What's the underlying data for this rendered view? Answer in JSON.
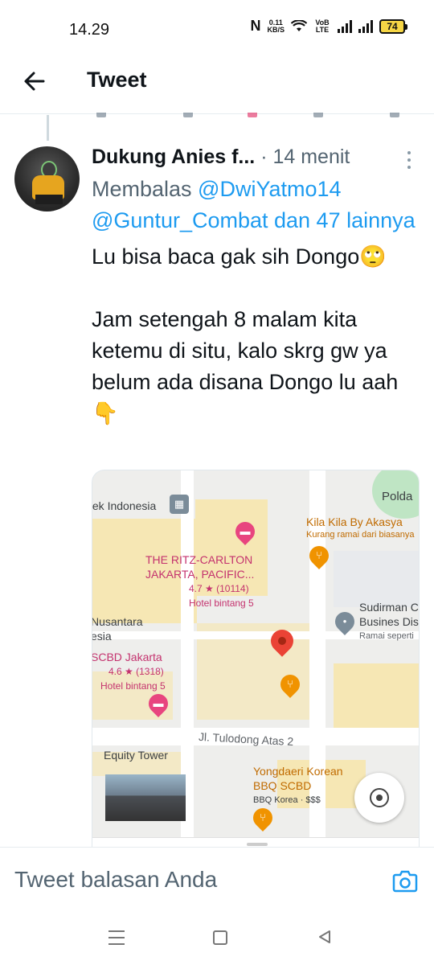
{
  "status_bar": {
    "time": "14.29",
    "net_speed_value": "0.11",
    "net_speed_unit": "KB/S",
    "volte": "VoB LTE",
    "battery": "74"
  },
  "header": {
    "title": "Tweet",
    "back_icon": "arrow-left-icon"
  },
  "tweet": {
    "author_name": "Dukung Anies f...",
    "separator": " · ",
    "timestamp": "14 menit",
    "reply_prefix": "Membalas ",
    "reply_mentions": "@DwiYatmo14 @Guntur_Combat dan 47 lainnya",
    "text": "Lu bisa baca gak sih Dongo🙄\n\nJam setengah 8 malam kita ketemu di situ, kalo skrg gw ya belum ada disana Dongo lu aah 👇"
  },
  "map": {
    "labels": {
      "fek_indonesia": "fek Indonesia",
      "polda": "Polda",
      "kila_kila": "Kila Kila By Akasya",
      "kila_kila_sub": "Kurang ramai dari biasanya",
      "ritz_1": "THE RITZ-CARLTON",
      "ritz_2": "JAKARTA, PACIFIC...",
      "ritz_rating": "4.7 ★ (10114)",
      "ritz_type": "Hotel bintang 5",
      "sudirman_1": "Sudirman C",
      "sudirman_2": "Busines Dis",
      "sudirman_3": "Ramai seperti",
      "nusantara_1": "Nusantara",
      "nusantara_2": "esia",
      "scbd": "SCBD Jakarta",
      "scbd_rating": "4.6 ★ (1318)",
      "scbd_type": "Hotel bintang 5",
      "street": "Jl. Tulodong Atas 2",
      "equity": "Equity Tower",
      "yongdaeri_1": "Yongdaeri Korean",
      "yongdaeri_2": "BBQ SCBD",
      "yongdaeri_sub": "BBQ Korea · $$$"
    },
    "colors": {
      "hotel_pink": "#e8457f",
      "food_orange": "#f09300",
      "pin_red": "#ea4335",
      "grey_poi": "#7b8c99"
    }
  },
  "reply_bar": {
    "placeholder": "Tweet balasan Anda",
    "camera_icon": "camera-icon"
  },
  "nav_bar": {
    "menu_icon": "recent-apps-icon",
    "home_icon": "home-icon",
    "back_icon": "back-triangle-icon"
  }
}
